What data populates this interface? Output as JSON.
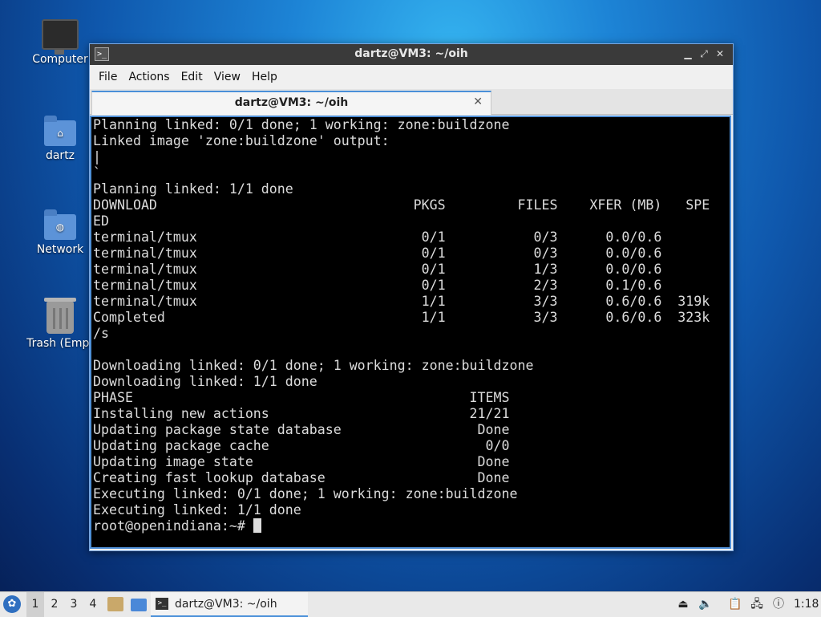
{
  "desktop": {
    "icons": [
      {
        "label": "Computer"
      },
      {
        "label": "dartz"
      },
      {
        "label": "Network"
      },
      {
        "label": "Trash (Empt"
      }
    ]
  },
  "window": {
    "title": "dartz@VM3: ~/oih",
    "menu": [
      "File",
      "Actions",
      "Edit",
      "View",
      "Help"
    ],
    "tab_title": "dartz@VM3: ~/oih",
    "terminal_lines": [
      "Planning linked: 0/1 done; 1 working: zone:buildzone",
      "Linked image 'zone:buildzone' output:",
      "|",
      "`",
      "Planning linked: 1/1 done",
      "DOWNLOAD                                PKGS         FILES    XFER (MB)   SPE",
      "ED",
      "terminal/tmux                            0/1           0/3      0.0/0.6",
      "terminal/tmux                            0/1           0/3      0.0/0.6",
      "terminal/tmux                            0/1           1/3      0.0/0.6",
      "terminal/tmux                            0/1           2/3      0.1/0.6",
      "terminal/tmux                            1/1           3/3      0.6/0.6  319k",
      "Completed                                1/1           3/3      0.6/0.6  323k",
      "/s",
      "",
      "Downloading linked: 0/1 done; 1 working: zone:buildzone",
      "Downloading linked: 1/1 done",
      "PHASE                                          ITEMS",
      "Installing new actions                         21/21",
      "Updating package state database                 Done",
      "Updating package cache                           0/0",
      "Updating image state                            Done",
      "Creating fast lookup database                   Done",
      "Executing linked: 0/1 done; 1 working: zone:buildzone",
      "Executing linked: 1/1 done"
    ],
    "prompt": "root@openindiana:~# "
  },
  "taskbar": {
    "workspaces": [
      "1",
      "2",
      "3",
      "4"
    ],
    "active_task": "dartz@VM3: ~/oih",
    "clock": "1:18"
  }
}
